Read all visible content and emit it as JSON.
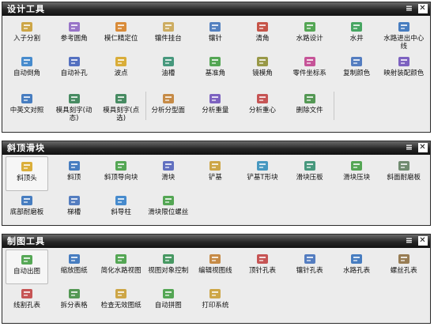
{
  "panels": [
    {
      "title": "设计工具",
      "rows": [
        [
          {
            "label": "入子分割",
            "icon": "split-insert-icon",
            "color": "#c89a2a"
          },
          {
            "label": "参考圆角",
            "icon": "reference-fillet-icon",
            "color": "#8a5fc2"
          },
          {
            "label": "模仁精定位",
            "icon": "core-locate-icon",
            "color": "#d67a1a"
          },
          {
            "label": "镶件挂台",
            "icon": "insert-hanger-icon",
            "color": "#c8a24a"
          },
          {
            "label": "镶针",
            "icon": "insert-pin-icon",
            "color": "#3a6fb8"
          },
          {
            "label": "清角",
            "icon": "corner-clear-icon",
            "color": "#c0392b"
          },
          {
            "label": "水路设计",
            "icon": "water-design-icon",
            "color": "#3a9a3a"
          },
          {
            "label": "水井",
            "icon": "water-well-icon",
            "color": "#2a9a4a"
          },
          {
            "label": "水路进出中心线",
            "icon": "water-centerline-icon",
            "color": "#2a6ab8"
          }
        ],
        [
          {
            "label": "自动倒角",
            "icon": "auto-chamfer-icon",
            "color": "#2a7ac8"
          },
          {
            "label": "自动补孔",
            "icon": "auto-patch-icon",
            "color": "#3a5ab8"
          },
          {
            "label": "波点",
            "icon": "wave-point-icon",
            "color": "#d6a21a"
          },
          {
            "label": "油槽",
            "icon": "oil-groove-icon",
            "color": "#2a8a6a"
          },
          {
            "label": "基准角",
            "icon": "datum-corner-icon",
            "color": "#3a9a3a"
          },
          {
            "label": "镜模角",
            "icon": "mirror-corner-icon",
            "color": "#8a8a2a"
          },
          {
            "label": "零件坐标系",
            "icon": "part-csys-icon",
            "color": "#c03a8a"
          },
          {
            "label": "复制颜色",
            "icon": "copy-color-icon",
            "color": "#3a6ab8"
          },
          {
            "label": "映射装配颜色",
            "icon": "map-assembly-color-icon",
            "color": "#6a4ab8"
          }
        ],
        [
          {
            "label": "中英文对照",
            "icon": "translate-icon",
            "color": "#2a6ab8"
          },
          {
            "label": "模具刻字(动态)",
            "icon": "engrave-dynamic-icon",
            "color": "#2a7a4a"
          },
          {
            "label": "模具刻字(点选)",
            "icon": "engrave-pick-icon",
            "color": "#2a7a4a"
          },
          {
            "label": "分析分型面",
            "icon": "parting-analysis-icon",
            "color": "#c07a2a"
          },
          {
            "label": "分析重量",
            "icon": "weight-analysis-icon",
            "color": "#6a4ab8"
          },
          {
            "label": "分析重心",
            "icon": "centroid-analysis-icon",
            "color": "#c03a3a"
          },
          {
            "label": "删除文件",
            "icon": "delete-file-icon",
            "color": "#3a8a3a"
          }
        ]
      ]
    },
    {
      "title": "斜顶滑块",
      "rows": [
        [
          {
            "label": "斜顶头",
            "icon": "lifter-head-icon",
            "color": "#d6a21a",
            "selected": true
          },
          {
            "label": "斜顶",
            "icon": "lifter-icon",
            "color": "#2a6ab8"
          },
          {
            "label": "斜顶导向块",
            "icon": "lifter-guide-icon",
            "color": "#3a9a3a"
          },
          {
            "label": "滑块",
            "icon": "slider-icon",
            "color": "#4a5ab8"
          },
          {
            "label": "铲基",
            "icon": "wedge-base-icon",
            "color": "#c89a2a"
          },
          {
            "label": "铲基T形块",
            "icon": "wedge-tblock-icon",
            "color": "#2a8ab8"
          },
          {
            "label": "滑块压板",
            "icon": "slider-plate-icon",
            "color": "#2a8a6a"
          },
          {
            "label": "滑块压块",
            "icon": "slider-block-icon",
            "color": "#3a9a3a"
          },
          {
            "label": "斜面耐磨板",
            "icon": "angle-wear-plate-icon",
            "color": "#5a7a5a"
          }
        ],
        [
          {
            "label": "底部耐磨板",
            "icon": "bottom-wear-plate-icon",
            "color": "#2a6ab8"
          },
          {
            "label": "梯槽",
            "icon": "dovetail-icon",
            "color": "#3a6ab8"
          },
          {
            "label": "斜导柱",
            "icon": "angle-pin-icon",
            "color": "#2a7ac8"
          },
          {
            "label": "滑块限位螺丝",
            "icon": "slider-stop-screw-icon",
            "color": "#3a9a3a"
          }
        ]
      ]
    },
    {
      "title": "制图工具",
      "rows": [
        [
          {
            "label": "自动出图",
            "icon": "auto-drawing-icon",
            "color": "#3a9a3a",
            "selected": true
          },
          {
            "label": "缩放图纸",
            "icon": "scale-sheet-icon",
            "color": "#2a6ab8"
          },
          {
            "label": "简化水路视图",
            "icon": "water-view-icon",
            "color": "#3a9a3a"
          },
          {
            "label": "视图对象控制",
            "icon": "view-object-icon",
            "color": "#2a8a4a"
          },
          {
            "label": "编辑视图线",
            "icon": "edit-view-line-icon",
            "color": "#c07a2a"
          },
          {
            "label": "顶针孔表",
            "icon": "ejector-table-icon",
            "color": "#c03a3a"
          },
          {
            "label": "镶针孔表",
            "icon": "pin-table-icon",
            "color": "#3a6ab8"
          },
          {
            "label": "水路孔表",
            "icon": "water-table-icon",
            "color": "#2a6ab8"
          },
          {
            "label": "螺丝孔表",
            "icon": "screw-table-icon",
            "color": "#8a6a3a"
          }
        ],
        [
          {
            "label": "线割孔表",
            "icon": "wire-cut-table-icon",
            "color": "#c03a3a"
          },
          {
            "label": "拆分表格",
            "icon": "split-table-icon",
            "color": "#3a8a3a"
          },
          {
            "label": "检查无效图纸",
            "icon": "check-sheet-icon",
            "color": "#c89a2a"
          },
          {
            "label": "自动拼图",
            "icon": "auto-layout-icon",
            "color": "#3a9a3a"
          },
          {
            "label": "打印系统",
            "icon": "print-icon",
            "color": "#c89a2a"
          }
        ]
      ]
    }
  ]
}
